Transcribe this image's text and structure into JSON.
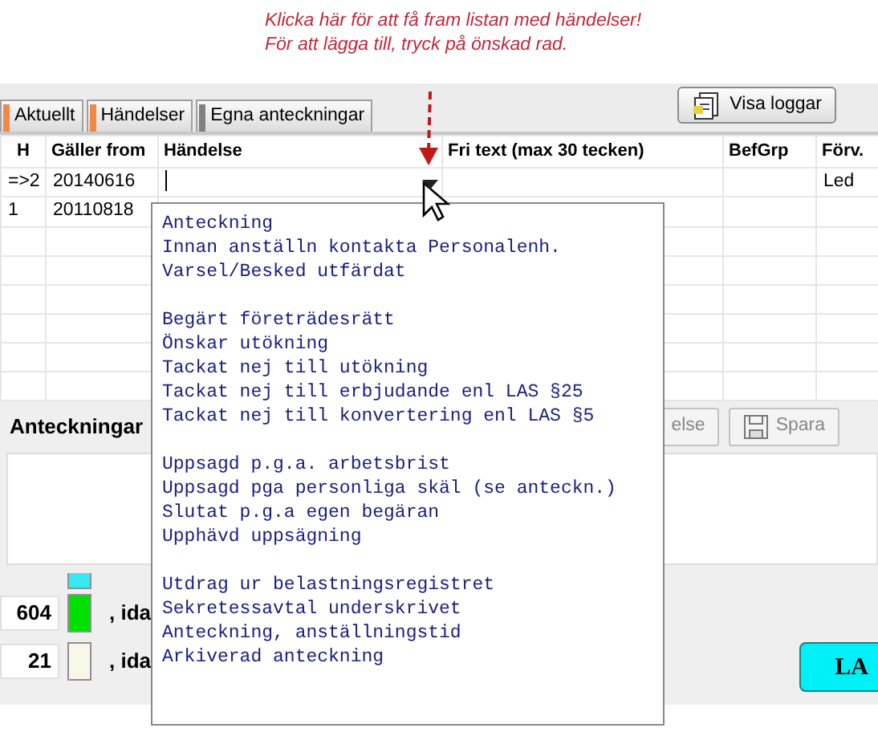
{
  "annotation": {
    "lines": [
      "Klicka här för att få fram listan med händelser!",
      "För att lägga till, tryck på önskad rad."
    ]
  },
  "tabs": [
    {
      "label": "Aktuellt",
      "color": "#f08848"
    },
    {
      "label": "Händelser",
      "color": "#f08848"
    },
    {
      "label": "Egna anteckningar",
      "color": "#808080"
    }
  ],
  "toolbar": {
    "button": "Visa loggar"
  },
  "table": {
    "columns": [
      "H",
      "Gäller from",
      "Händelse",
      "Fri text (max 30 tecken)",
      "BefGrp",
      "Förv."
    ],
    "rows": [
      {
        "cells": [
          "=>2",
          "20140616",
          "",
          "",
          "",
          "Led"
        ],
        "editing": true
      },
      {
        "cells": [
          "1",
          "20110818",
          "",
          "",
          "",
          ""
        ],
        "editing": false
      }
    ]
  },
  "dropdown": {
    "groups": [
      [
        "Anteckning",
        "Innan anställn kontakta Personalenh.",
        "Varsel/Besked utfärdat"
      ],
      [
        "Begärt företrädesrätt",
        "Önskar utökning",
        "Tackat nej till utökning",
        "Tackat nej till erbjudande enl LAS §25",
        "Tackat nej till konvertering enl LAS §5"
      ],
      [
        "Uppsagd p.g.a. arbetsbrist",
        "Uppsagd pga personliga skäl (se anteckn.)",
        "Slutat p.g.a egen begäran",
        "Upphävd uppsägning"
      ],
      [
        "Utdrag ur belastningsregistret",
        "Sekretessavtal underskrivet",
        "Anteckning, anställningstid",
        "Arkiverad anteckning"
      ]
    ]
  },
  "notes": {
    "label": "Anteckningar",
    "buttons": [
      "else",
      "Spara"
    ]
  },
  "indicators": [
    {
      "color": "#38e8f0"
    },
    {
      "value": "604",
      "color": "#00e000",
      "label": ", ida"
    },
    {
      "value": "21",
      "color": "#f8f8e8",
      "label": ", ida"
    }
  ],
  "la_button": "LA"
}
